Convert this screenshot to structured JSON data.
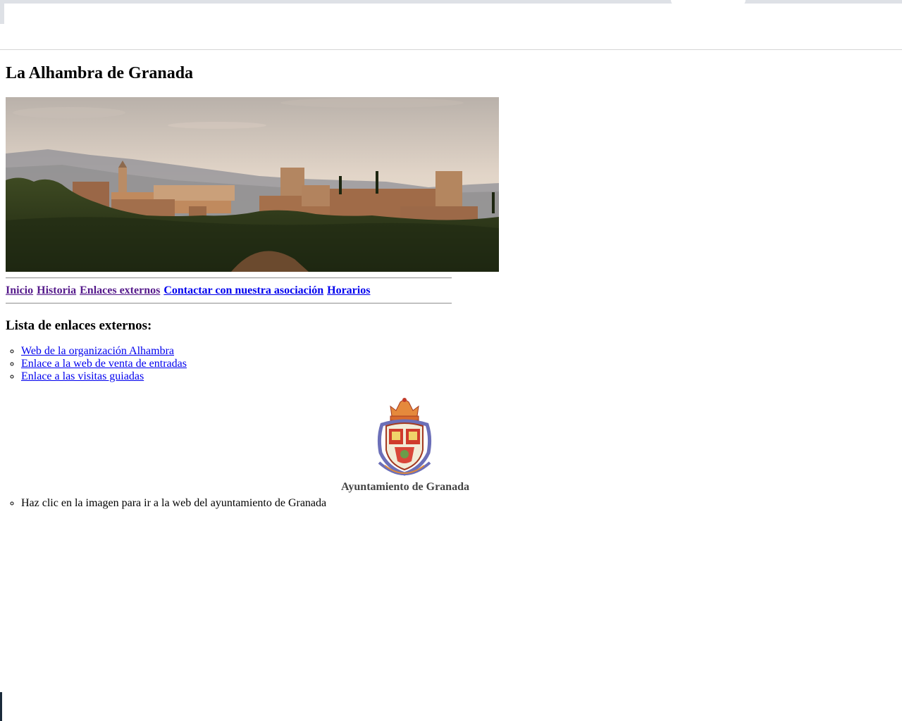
{
  "page": {
    "title": "La Alhambra de Granada"
  },
  "nav": {
    "items": [
      {
        "label": "Inicio",
        "visited": true
      },
      {
        "label": "Historia",
        "visited": true
      },
      {
        "label": "Enlaces externos",
        "visited": true
      },
      {
        "label": "Contactar con nuestra asociación",
        "visited": false
      },
      {
        "label": "Horarios",
        "visited": false
      }
    ]
  },
  "links_section": {
    "heading": "Lista de enlaces externos:",
    "items": [
      {
        "label": "Web de la organización Alhambra"
      },
      {
        "label": "Enlace a la web de venta de entradas"
      },
      {
        "label": "Enlace a las visitas guiadas"
      }
    ]
  },
  "crest": {
    "caption": "Ayuntamiento de Granada",
    "note": "Haz clic en la imagen para ir a la web del ayuntamiento de Granada"
  },
  "colors": {
    "link": "#0000ee",
    "visited_link": "#551a8b"
  }
}
